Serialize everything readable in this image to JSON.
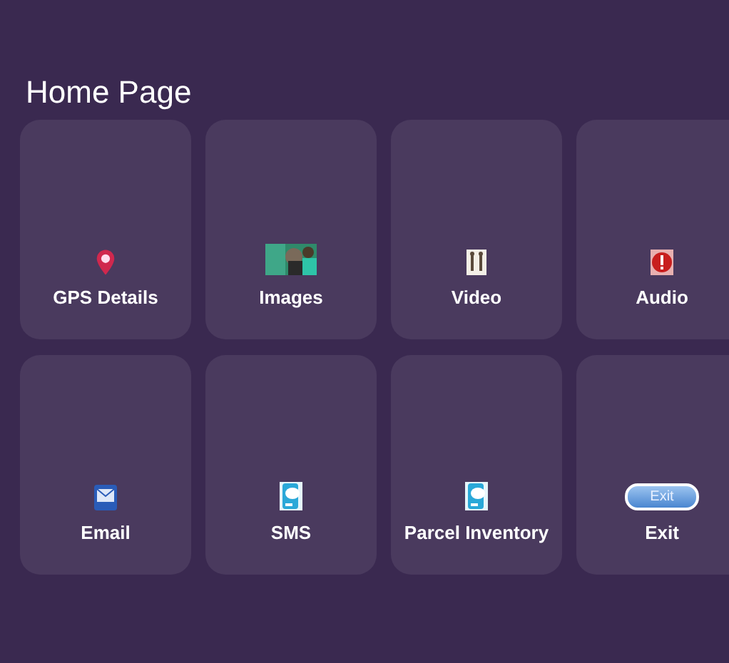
{
  "header": {
    "title": "Home Page"
  },
  "tiles": [
    {
      "label": "GPS Details",
      "kind": "pin"
    },
    {
      "label": "Images"
    },
    {
      "label": "Video",
      "kind": "video"
    },
    {
      "label": "Audio",
      "kind": "audio"
    },
    {
      "label": "Email",
      "kind": "email"
    },
    {
      "label": "SMS",
      "kind": "phone"
    },
    {
      "label": "Parcel Inventory",
      "kind": "phone"
    },
    {
      "label": "Exit",
      "kind": "exit",
      "icon_text": "Exit"
    }
  ]
}
